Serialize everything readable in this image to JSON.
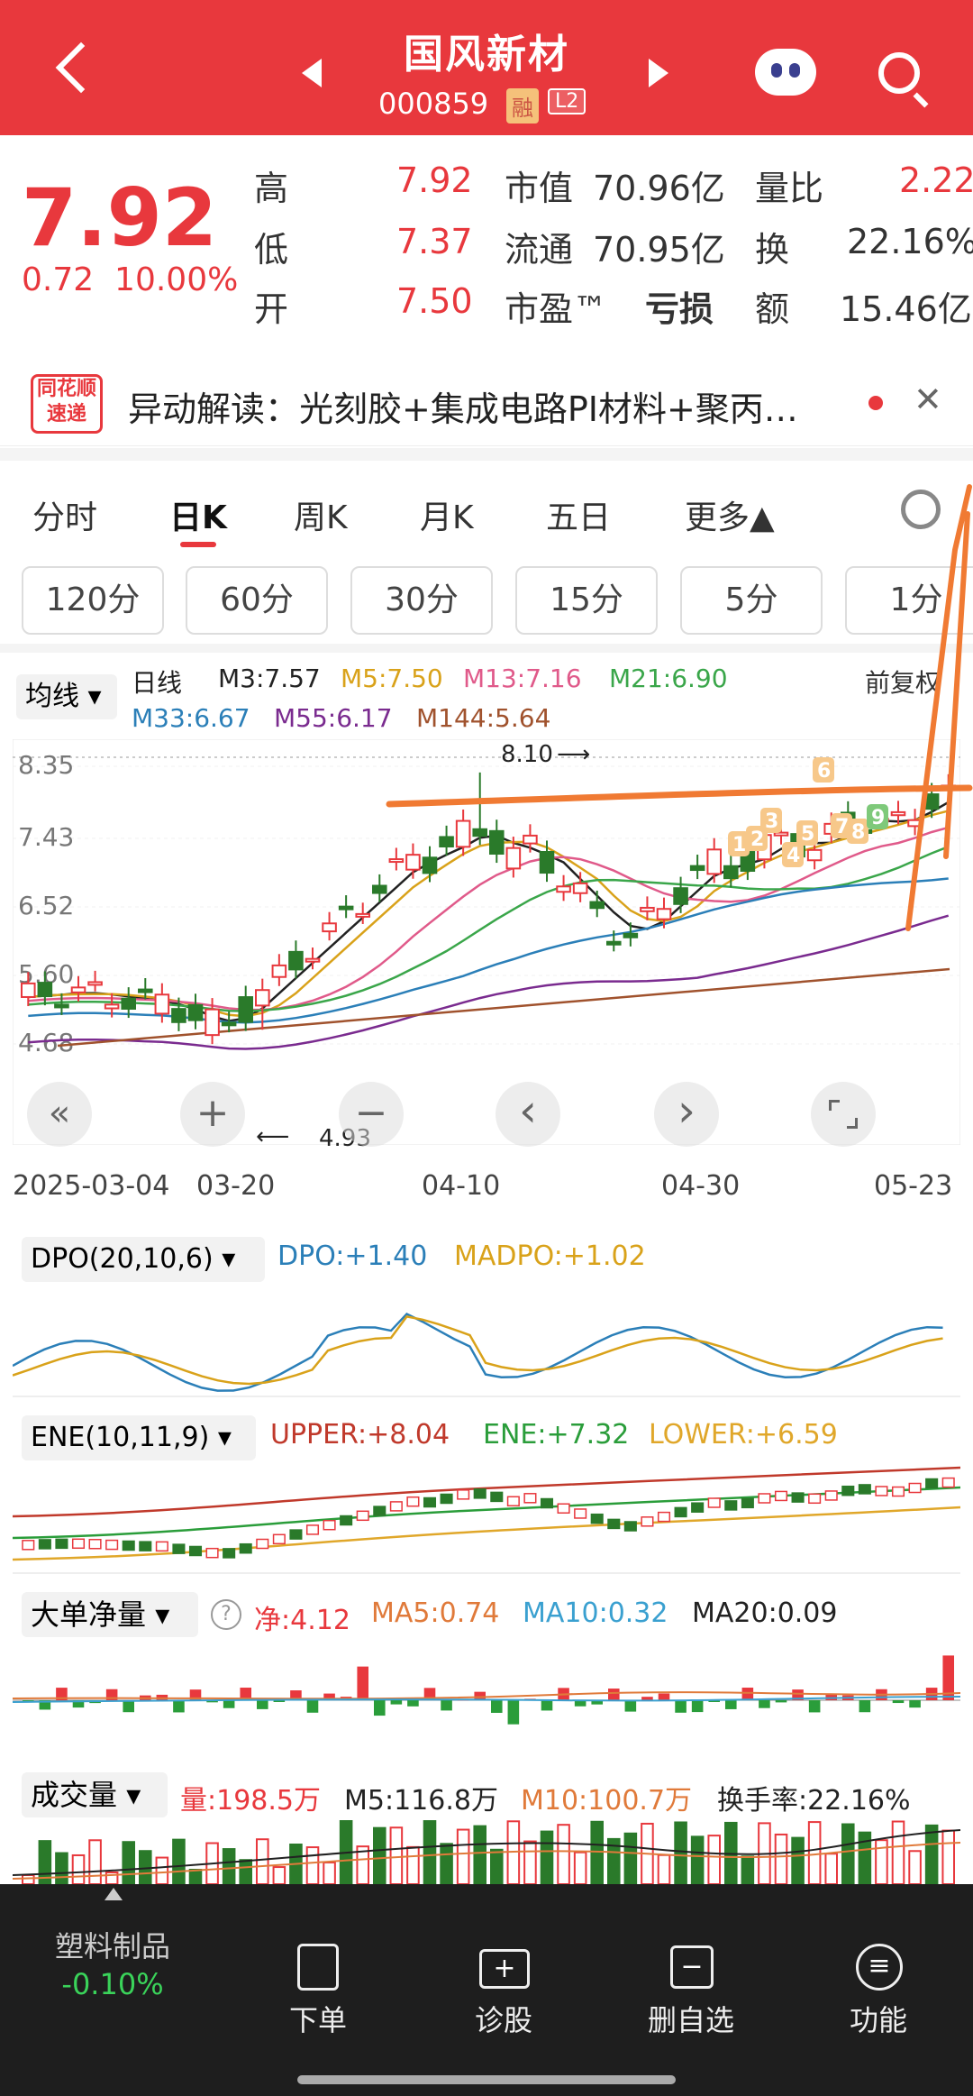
{
  "header": {
    "title": "国风新材",
    "code": "000859",
    "tag_rong": "融",
    "tag_l2": "L2"
  },
  "quote": {
    "price": "7.92",
    "change": "0.72",
    "change_pct": "10.00%",
    "cells": [
      {
        "label": "高",
        "value": "7.92"
      },
      {
        "label": "市值",
        "value": "70.96亿"
      },
      {
        "label": "量比",
        "value": "2.22"
      },
      {
        "label": "低",
        "value": "7.37"
      },
      {
        "label": "流通",
        "value": "70.95亿"
      },
      {
        "label": "换",
        "value": "22.16%"
      },
      {
        "label": "开",
        "value": "7.50"
      },
      {
        "label": "市盈™",
        "value": "亏损"
      },
      {
        "label": "额",
        "value": "15.46亿"
      }
    ]
  },
  "news": {
    "logo_line1": "同花顺",
    "logo_line2": "速递",
    "text": "异动解读：光刻胶+集成电路PI材料+聚丙…"
  },
  "tabs": [
    "分时",
    "日K",
    "周K",
    "月K",
    "五日",
    "更多▲"
  ],
  "intervals": [
    "120分",
    "60分",
    "30分",
    "15分",
    "5分",
    "1分"
  ],
  "ma": {
    "selector": "均线",
    "line": "日线",
    "m3": "M3:7.57",
    "m5": "M5:7.50",
    "m13": "M13:7.16",
    "m21": "M21:6.90",
    "m33": "M33:6.67",
    "m55": "M55:6.17",
    "m144": "M144:5.64",
    "adjust": "前复权"
  },
  "chart_data": {
    "type": "candlestick",
    "yticks": [
      "8.35",
      "7.43",
      "6.52",
      "5.60",
      "4.68"
    ],
    "dates": [
      "2025-03-04",
      "03-20",
      "04-10",
      "04-30",
      "05-23"
    ],
    "high_label": "8.10",
    "low_label": "4.93",
    "markers": [
      "1",
      "2",
      "3",
      "4",
      "5",
      "6",
      "7",
      "8",
      "9"
    ]
  },
  "controls": {
    "zoom_in": "+",
    "zoom_out": "−",
    "left": "‹",
    "right": "›"
  },
  "dpo": {
    "selector": "DPO(20,10,6)",
    "dpo": "DPO:+1.40",
    "madpo": "MADPO:+1.02"
  },
  "ene": {
    "selector": "ENE(10,11,9)",
    "upper": "UPPER:+8.04",
    "ene": "ENE:+7.32",
    "lower": "LOWER:+6.59"
  },
  "bigorder": {
    "selector": "大单净量",
    "net": "净:4.12",
    "ma5": "MA5:0.74",
    "ma10": "MA10:0.32",
    "ma20": "MA20:0.09"
  },
  "volume": {
    "selector": "成交量",
    "vol": "量:198.5万",
    "m5": "M5:116.8万",
    "m10": "M10:100.7万",
    "turnover": "换手率:22.16%"
  },
  "bottom": {
    "sector": "塑料制品",
    "sector_chg": "-0.10%",
    "items": [
      "下单",
      "诊股",
      "删自选",
      "功能"
    ]
  },
  "colors": {
    "red": "#e8383d",
    "green": "#2a9d3a",
    "accent": "#e8383d"
  }
}
